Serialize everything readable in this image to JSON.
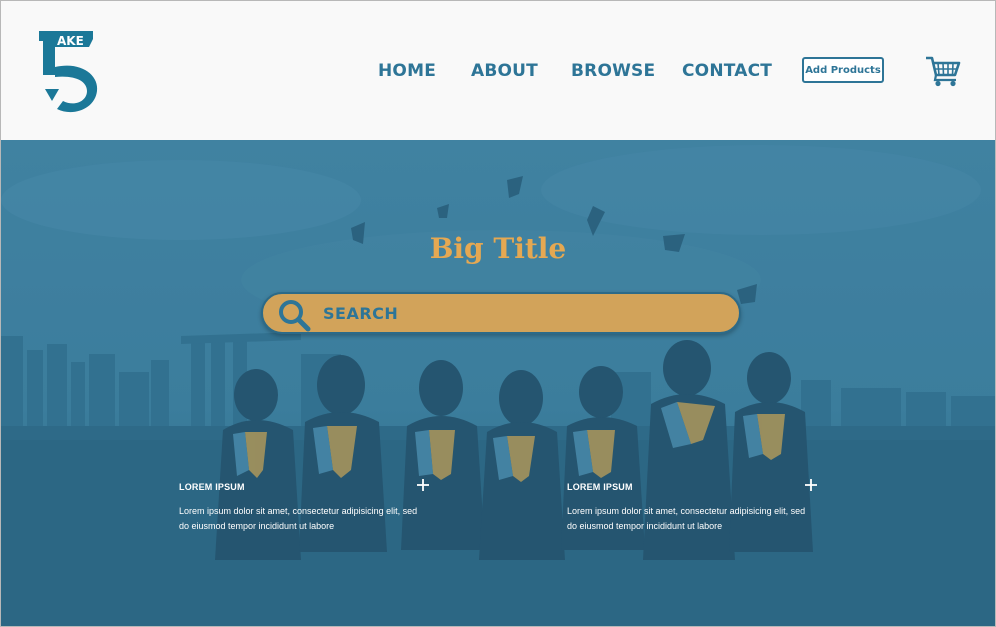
{
  "brand": {
    "logo_text": "AKE",
    "logo_name": "Take 5"
  },
  "nav": {
    "items": [
      {
        "label": "HOME"
      },
      {
        "label": "ABOUT"
      },
      {
        "label": "BROWSE"
      },
      {
        "label": "CONTACT"
      }
    ],
    "add_products_label": "Add Products",
    "cart_icon": "shopping-cart-icon"
  },
  "hero": {
    "title": "Big Title",
    "search": {
      "placeholder": "SEARCH",
      "value": "",
      "icon": "search-icon"
    },
    "background": "graduates-tossing-caps photo"
  },
  "cards": [
    {
      "title": "LOREM IPSUM",
      "text": "Lorem ipsum dolor sit amet, consectetur adipisicing elit, sed do eiusmod tempor incididunt ut labore",
      "icon": "plus-icon"
    },
    {
      "title": "LOREM IPSUM",
      "text": "Lorem ipsum dolor sit amet, consectetur adipisicing elit, sed do eiusmod tempor incididunt ut labore",
      "icon": "plus-icon"
    }
  ],
  "colors": {
    "primary": "#2e7597",
    "hero_overlay": "#3b7b9a",
    "title_accent": "#e5a852",
    "search_bg": "#d2a35a",
    "header_bg": "#f9f9f9"
  }
}
